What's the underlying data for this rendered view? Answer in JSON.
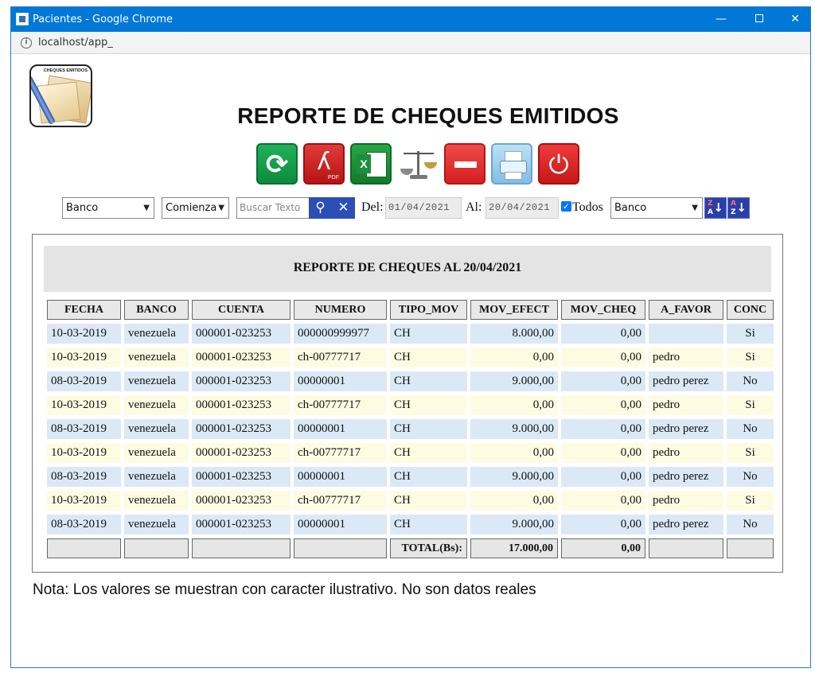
{
  "window": {
    "title": "Pacientes - Google Chrome",
    "url": "localhost/app_",
    "controls": {
      "minimize": "—",
      "close": "✕"
    }
  },
  "logo": {
    "text": "CHEQUES EMITIDOS"
  },
  "page": {
    "title": "REPORTE DE CHEQUES EMITIDOS"
  },
  "toolbar": {
    "icons": [
      "refresh-icon",
      "pdf-icon",
      "excel-icon",
      "balance-icon",
      "minus-icon",
      "print-icon",
      "power-icon"
    ],
    "pdf_label": "PDF",
    "excel_label": "X"
  },
  "filters": {
    "banco_select": "Banco",
    "match_select": "Comienza",
    "search_placeholder": "Buscar Texto",
    "del_label": "Del:",
    "del_value": "01/04/2021",
    "al_label": "Al:",
    "al_value": "20/04/2021",
    "todos_label": "Todos",
    "todos_checked": true,
    "sort_select": "Banco",
    "sort_az": {
      "l1": "Z",
      "l2": "A"
    },
    "sort_za": {
      "l1": "A",
      "l2": "Z"
    }
  },
  "report": {
    "heading": "REPORTE DE CHEQUES AL 20/04/2021",
    "columns": [
      "FECHA",
      "BANCO",
      "CUENTA",
      "NUMERO",
      "TIPO_MOV",
      "MOV_EFECT",
      "MOV_CHEQ",
      "A_FAVOR",
      "CONC"
    ],
    "rows": [
      {
        "style": "blue",
        "cells": [
          "10-03-2019",
          "venezuela",
          "000001-023253",
          "000000999977",
          "CH",
          "8.000,00",
          "0,00",
          "",
          "Si"
        ]
      },
      {
        "style": "yellow",
        "cells": [
          "10-03-2019",
          "venezuela",
          "000001-023253",
          "ch-00777717",
          "CH",
          "0,00",
          "0,00",
          "pedro",
          "Si"
        ]
      },
      {
        "style": "blue",
        "cells": [
          "08-03-2019",
          "venezuela",
          "000001-023253",
          "00000001",
          "CH",
          "9.000,00",
          "0,00",
          "pedro perez",
          "No"
        ]
      },
      {
        "style": "yellow",
        "cells": [
          "10-03-2019",
          "venezuela",
          "000001-023253",
          "ch-00777717",
          "CH",
          "0,00",
          "0,00",
          "pedro",
          "Si"
        ]
      },
      {
        "style": "blue",
        "cells": [
          "08-03-2019",
          "venezuela",
          "000001-023253",
          "00000001",
          "CH",
          "9.000,00",
          "0,00",
          "pedro perez",
          "No"
        ]
      },
      {
        "style": "yellow",
        "cells": [
          "10-03-2019",
          "venezuela",
          "000001-023253",
          "ch-00777717",
          "CH",
          "0,00",
          "0,00",
          "pedro",
          "Si"
        ]
      },
      {
        "style": "blue",
        "cells": [
          "08-03-2019",
          "venezuela",
          "000001-023253",
          "00000001",
          "CH",
          "9.000,00",
          "0,00",
          "pedro perez",
          "No"
        ]
      },
      {
        "style": "yellow",
        "cells": [
          "10-03-2019",
          "venezuela",
          "000001-023253",
          "ch-00777717",
          "CH",
          "0,00",
          "0,00",
          "pedro",
          "Si"
        ]
      },
      {
        "style": "blue",
        "cells": [
          "08-03-2019",
          "venezuela",
          "000001-023253",
          "00000001",
          "CH",
          "9.000,00",
          "0,00",
          "pedro perez",
          "No"
        ]
      }
    ],
    "total": {
      "label": "TOTAL(Bs):",
      "mov_efect": "17.000,00",
      "mov_cheq": "0,00"
    }
  },
  "nota": "Nota: Los valores se muestran con caracter ilustrativo. No son datos reales",
  "colors": {
    "titlebar": "#0078d7",
    "row_blue": "#dbe9f6",
    "row_yellow": "#fdfce3",
    "header_bg": "#e8e8e8",
    "button_blue": "#2a4fb5"
  }
}
